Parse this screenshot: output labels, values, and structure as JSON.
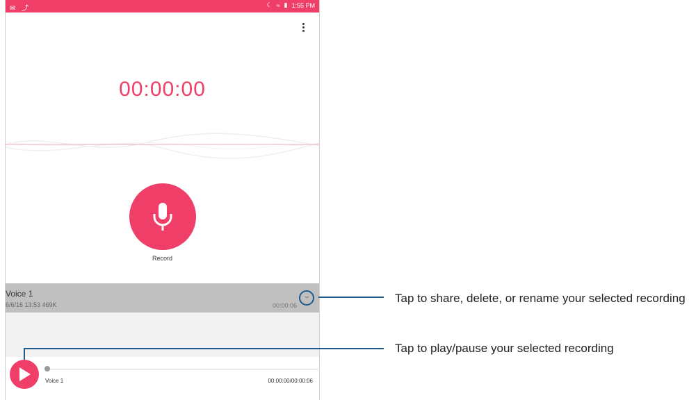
{
  "status_bar": {
    "time": "1:55 PM",
    "left_icons": [
      "message-icon",
      "notification-icon"
    ],
    "right_icons": [
      "moon-icon",
      "wifi-icon",
      "battery-charging-icon"
    ]
  },
  "recorder": {
    "timer": "00:00:00",
    "record_label": "Record"
  },
  "recording": {
    "title": "Voice 1",
    "meta": "6/6/16 13:53  469K",
    "duration": "00:00:06"
  },
  "player": {
    "name": "Voice 1",
    "time": "00:00:00/00:00:06"
  },
  "callouts": {
    "expand": "Tap to share, delete, or rename your selected recording",
    "play": "Tap to play/pause your selected recording"
  },
  "colors": {
    "accent": "#ef3e68",
    "callout_line": "#1d5a8e",
    "list_row": "#c0c0c0"
  }
}
